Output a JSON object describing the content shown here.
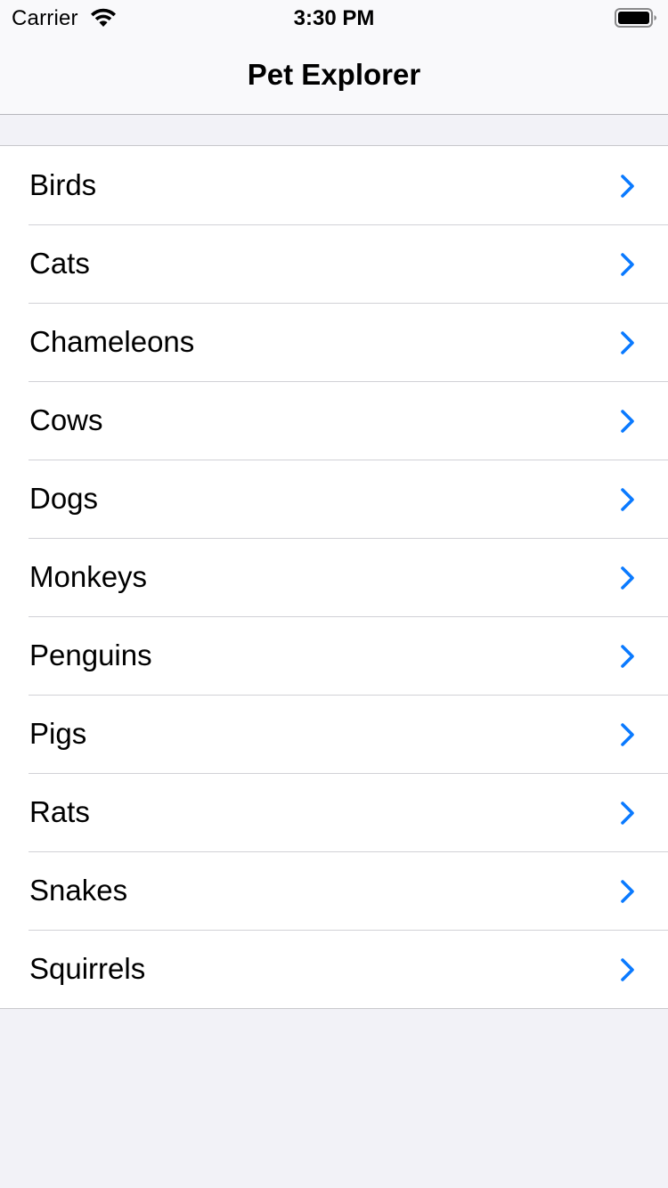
{
  "status_bar": {
    "carrier": "Carrier",
    "time": "3:30 PM"
  },
  "nav": {
    "title": "Pet Explorer"
  },
  "list": {
    "accent_color": "#0a7aff",
    "items": [
      {
        "label": "Birds"
      },
      {
        "label": "Cats"
      },
      {
        "label": "Chameleons"
      },
      {
        "label": "Cows"
      },
      {
        "label": "Dogs"
      },
      {
        "label": "Monkeys"
      },
      {
        "label": "Penguins"
      },
      {
        "label": "Pigs"
      },
      {
        "label": "Rats"
      },
      {
        "label": "Snakes"
      },
      {
        "label": "Squirrels"
      }
    ]
  }
}
